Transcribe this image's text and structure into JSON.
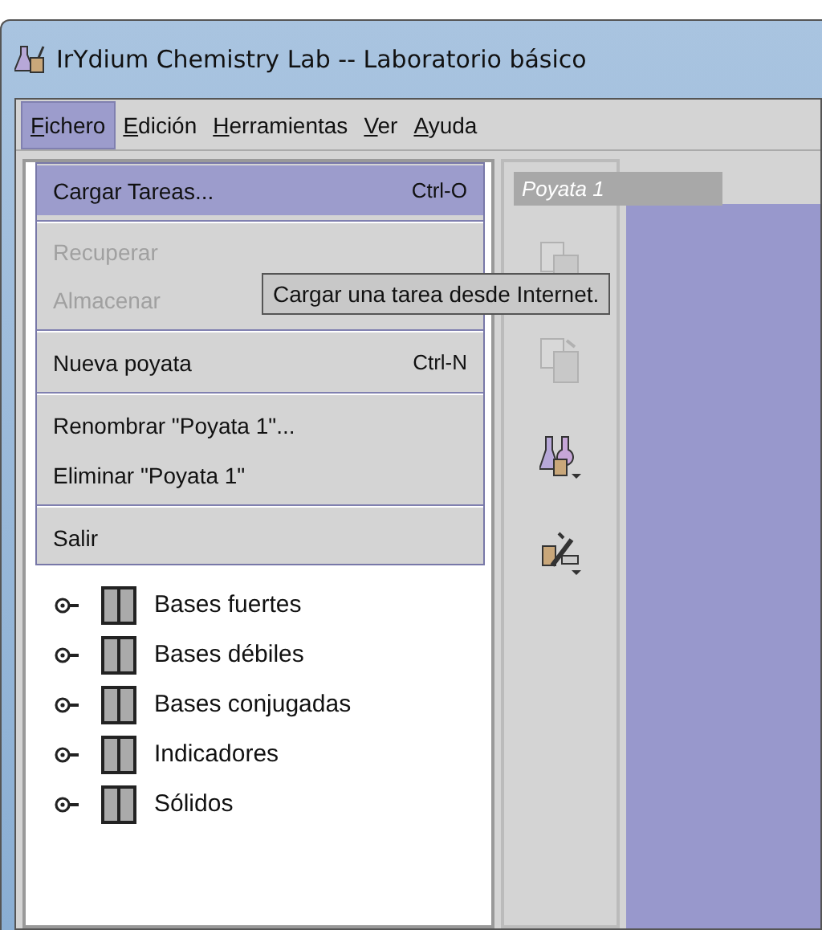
{
  "window": {
    "title": "IrYdium Chemistry Lab -- Laboratorio básico"
  },
  "menubar": [
    {
      "label": "Fichero",
      "selected": true
    },
    {
      "label": "Edición",
      "selected": false
    },
    {
      "label": "Herramientas",
      "selected": false
    },
    {
      "label": "Ver",
      "selected": false
    },
    {
      "label": "Ayuda",
      "selected": false
    }
  ],
  "menu": {
    "groups": [
      [
        {
          "label": "Cargar Tareas...",
          "shortcut": "Ctrl-O",
          "selected": true,
          "disabled": false
        }
      ],
      [
        {
          "label": "Recuperar",
          "selected": false,
          "disabled": true
        },
        {
          "label": "Almacenar",
          "selected": false,
          "disabled": true
        }
      ],
      [
        {
          "label": "Nueva poyata",
          "shortcut": "Ctrl-N",
          "selected": false,
          "disabled": false
        }
      ],
      [
        {
          "label": "Renombrar \"Poyata 1\"...",
          "selected": false,
          "disabled": false
        },
        {
          "label": "Eliminar \"Poyata 1\"",
          "selected": false,
          "disabled": false
        }
      ],
      [
        {
          "label": "Salir",
          "selected": false,
          "disabled": false
        }
      ]
    ]
  },
  "tooltip": "Cargar una tarea desde Internet.",
  "tree": {
    "items": [
      {
        "label": "Bases fuertes",
        "expanded": false
      },
      {
        "label": "Bases débiles",
        "expanded": false
      },
      {
        "label": "Bases conjugadas",
        "expanded": false
      },
      {
        "label": "Indicadores",
        "expanded": false
      },
      {
        "label": "Sólidos",
        "expanded": false
      }
    ]
  },
  "workbench": {
    "tab": "Poyata 1",
    "tools": [
      {
        "kind": "copy",
        "disabled": true
      },
      {
        "kind": "paste",
        "disabled": true
      },
      {
        "kind": "flasks",
        "disabled": false
      },
      {
        "kind": "tools",
        "disabled": false
      }
    ]
  }
}
